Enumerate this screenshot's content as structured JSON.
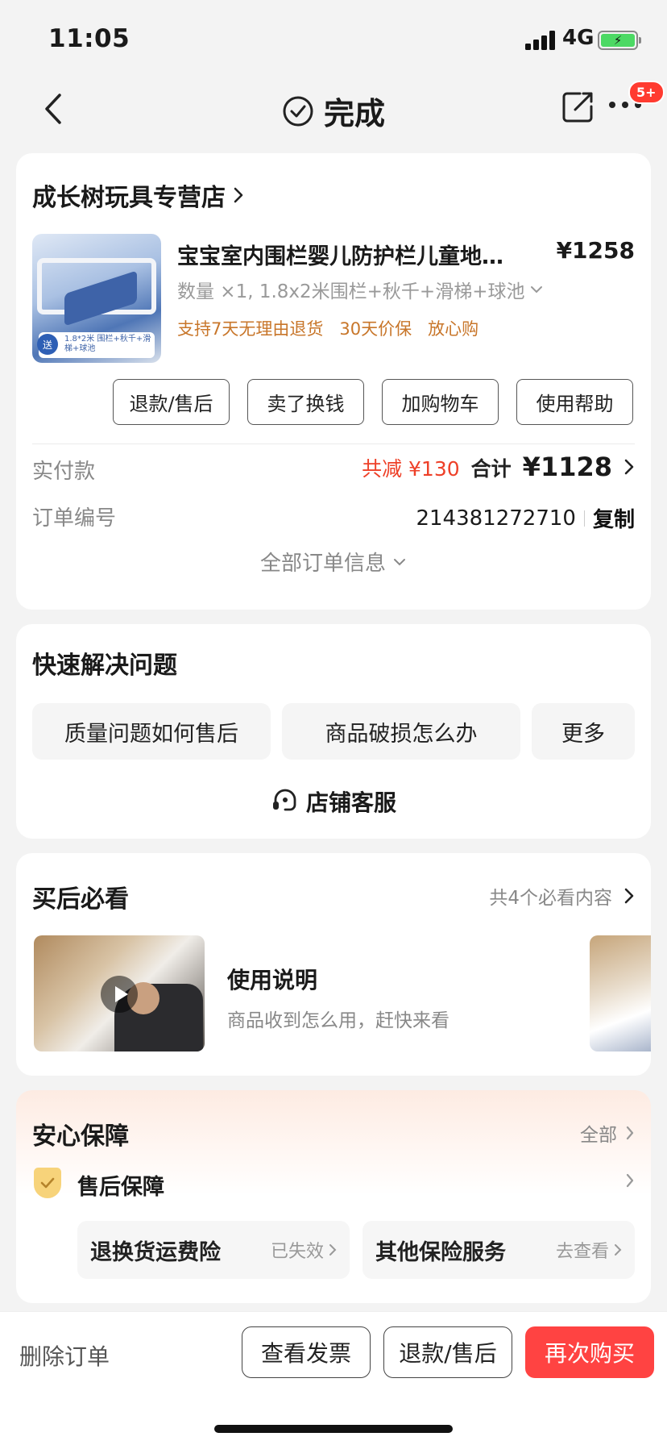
{
  "status_bar": {
    "time": "11:05",
    "network": "4G",
    "battery_color": "#4cd964"
  },
  "nav": {
    "title": "完成",
    "title_icon": "check-circle-icon",
    "badge": "5+"
  },
  "order": {
    "shop_name": "成长树玩具专营店",
    "product": {
      "title": "宝宝室内围栏婴儿防护栏儿童地垫爬行垫",
      "price": "¥1258",
      "spec": "数量 ×1, 1.8x2米围栏+秋千+滑梯+球池",
      "guarantees": [
        "支持7天无理由退货",
        "30天价保",
        "放心购"
      ],
      "thumb_badge": "送",
      "thumb_caption": "1.8*2米 围栏+秋千+滑梯+球池"
    },
    "actions": [
      "退款/售后",
      "卖了换钱",
      "加购物车",
      "使用帮助"
    ],
    "paid_label": "实付款",
    "discount": "共减 ¥130",
    "total_label": "合计",
    "total_value": "¥1128",
    "order_no_label": "订单编号",
    "order_no": "214381272710",
    "copy_label": "复制",
    "all_info_label": "全部订单信息"
  },
  "quick": {
    "title": "快速解决问题",
    "items": [
      "质量问题如何售后",
      "商品破损怎么办",
      "更多"
    ],
    "service_label": "店铺客服"
  },
  "must_see": {
    "title": "买后必看",
    "more_label": "共4个必看内容",
    "item_title": "使用说明",
    "item_desc": "商品收到怎么用，赶快来看"
  },
  "safe": {
    "title": "安心保障",
    "all_label": "全部",
    "after_sale_label": "售后保障",
    "insurance": [
      {
        "name": "退换货运费险",
        "status": "已失效"
      },
      {
        "name": "其他保险服务",
        "status": "去查看"
      }
    ]
  },
  "bottom": {
    "delete_label": "删除订单",
    "invoice_label": "查看发票",
    "refund_label": "退款/售后",
    "rebuy_label": "再次购买",
    "primary_color": "#ff4342"
  }
}
